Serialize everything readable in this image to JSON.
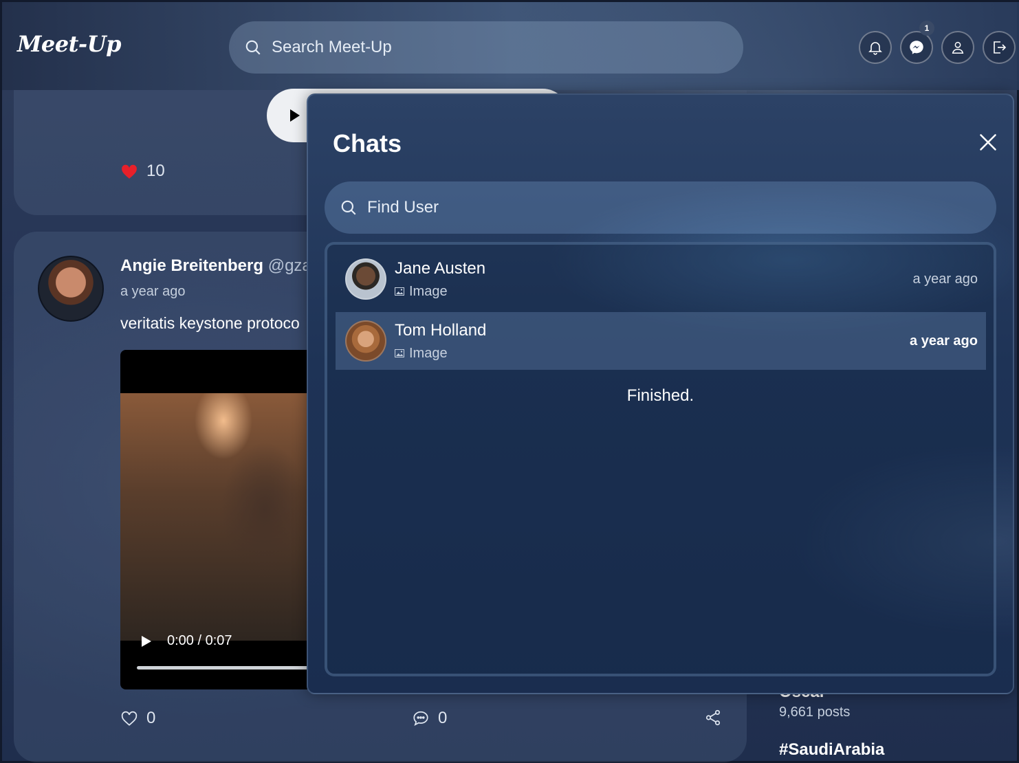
{
  "app": {
    "logo": "Meet-Up"
  },
  "header": {
    "search_placeholder": "Search Meet-Up",
    "messenger_badge": "1"
  },
  "feed": {
    "top_post": {
      "likes": "10"
    },
    "post": {
      "author": "Angie Breitenberg",
      "handle": "@gza",
      "time": "a year ago",
      "text": "veritatis keystone protoco",
      "video_time": "0:00 / 0:07",
      "likes": "0",
      "comments": "0"
    }
  },
  "trends": {
    "name": "Oscar",
    "count": "9,661 posts",
    "tag": "#SaudiArabia"
  },
  "chats": {
    "title": "Chats",
    "find_placeholder": "Find User",
    "items": [
      {
        "name": "Jane Austen",
        "preview": "Image",
        "time": "a year ago",
        "active": false
      },
      {
        "name": "Tom Holland",
        "preview": "Image",
        "time": "a year ago",
        "active": true
      }
    ],
    "status": "Finished."
  }
}
